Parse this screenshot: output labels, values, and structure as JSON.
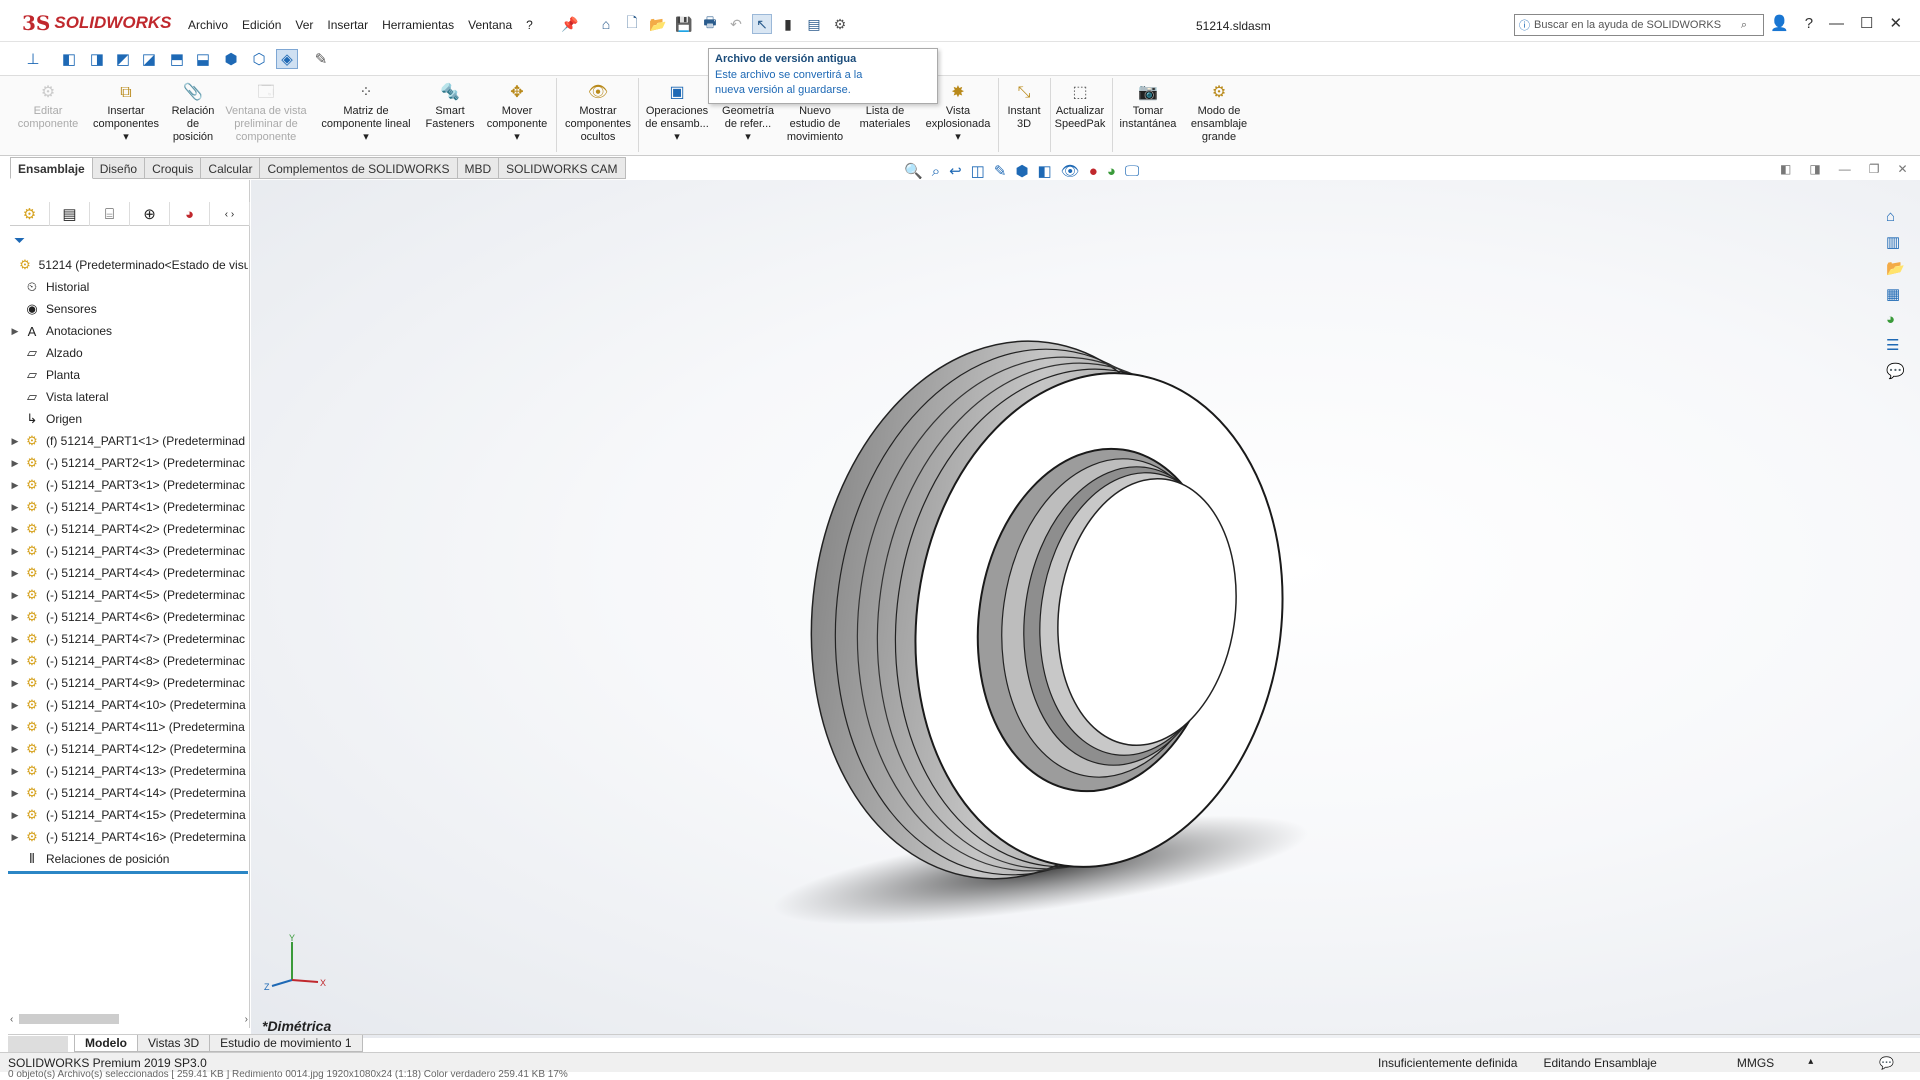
{
  "app": {
    "logo_ds": "3S",
    "logo_name": "SOLIDWORKS",
    "document_title": "51214.sldasm"
  },
  "menu": [
    "Archivo",
    "Edición",
    "Ver",
    "Insertar",
    "Herramientas",
    "Ventana",
    "?"
  ],
  "help_search": {
    "placeholder": "Buscar en la ayuda de SOLIDWORKS"
  },
  "tooltip": {
    "title": "Archivo de versión antigua",
    "line1": "Este archivo se convertirá a la",
    "line2": "nueva versión al guardarse."
  },
  "ribbon": [
    {
      "l1": "Editar",
      "l2": "componente",
      "l3": "",
      "l4": "",
      "icon": "edit-component-icon",
      "disabled": true
    },
    {
      "l1": "Insertar",
      "l2": "componentes",
      "l3": "▾",
      "l4": "",
      "icon": "insert-components-icon",
      "disabled": false
    },
    {
      "l1": "Relación",
      "l2": "de",
      "l3": "posición",
      "l4": "",
      "icon": "mate-icon",
      "disabled": false
    },
    {
      "l1": "Ventana de vista",
      "l2": "preliminar de",
      "l3": "componente",
      "l4": "",
      "icon": "preview-window-icon",
      "disabled": true
    },
    {
      "l1": "Matriz de",
      "l2": "componente lineal",
      "l3": "▾",
      "l4": "",
      "icon": "linear-pattern-icon",
      "disabled": false
    },
    {
      "l1": "Smart",
      "l2": "Fasteners",
      "l3": "",
      "l4": "",
      "icon": "smart-fasteners-icon",
      "disabled": false
    },
    {
      "l1": "Mover",
      "l2": "componente",
      "l3": "▾",
      "l4": "",
      "icon": "move-component-icon",
      "disabled": false
    },
    {
      "l1": "Mostrar",
      "l2": "componentes",
      "l3": "ocultos",
      "l4": "",
      "icon": "show-hidden-icon",
      "disabled": false
    },
    {
      "l1": "Operaciones",
      "l2": "de ensamb...",
      "l3": "▾",
      "l4": "",
      "icon": "assembly-features-icon",
      "disabled": false
    },
    {
      "l1": "Geometría",
      "l2": "de refer...",
      "l3": "▾",
      "l4": "",
      "icon": "reference-geometry-icon",
      "disabled": false
    },
    {
      "l1": "Nuevo",
      "l2": "estudio de",
      "l3": "movimiento",
      "l4": "",
      "icon": "motion-study-icon",
      "disabled": false
    },
    {
      "l1": "Lista de",
      "l2": "materiales",
      "l3": "",
      "l4": "",
      "icon": "bom-icon",
      "disabled": false
    },
    {
      "l1": "Vista",
      "l2": "explosionada",
      "l3": "▾",
      "l4": "",
      "icon": "exploded-view-icon",
      "disabled": false
    },
    {
      "l1": "Instant",
      "l2": "3D",
      "l3": "",
      "l4": "",
      "icon": "instant3d-icon",
      "disabled": false
    },
    {
      "l1": "Actualizar",
      "l2": "SpeedPak",
      "l3": "",
      "l4": "",
      "icon": "speedpak-icon",
      "disabled": false
    },
    {
      "l1": "Tomar",
      "l2": "instantánea",
      "l3": "",
      "l4": "",
      "icon": "snapshot-icon",
      "disabled": false
    },
    {
      "l1": "Modo de",
      "l2": "ensamblaje",
      "l3": "grande",
      "l4": "",
      "icon": "large-assembly-icon",
      "disabled": false
    }
  ],
  "command_tabs": [
    "Ensamblaje",
    "Diseño",
    "Croquis",
    "Calcular",
    "Complementos de SOLIDWORKS",
    "MBD",
    "SOLIDWORKS CAM"
  ],
  "tree": {
    "root": "51214  (Predeterminado<Estado de visua",
    "items": [
      {
        "label": "Historial",
        "icon": "history-icon",
        "expandable": false,
        "component": false
      },
      {
        "label": "Sensores",
        "icon": "sensors-icon",
        "expandable": false,
        "component": false
      },
      {
        "label": "Anotaciones",
        "icon": "annotations-icon",
        "expandable": true,
        "component": false
      },
      {
        "label": "Alzado",
        "icon": "plane-icon",
        "expandable": false,
        "component": false
      },
      {
        "label": "Planta",
        "icon": "plane-icon",
        "expandable": false,
        "component": false
      },
      {
        "label": "Vista lateral",
        "icon": "plane-icon",
        "expandable": false,
        "component": false
      },
      {
        "label": "Origen",
        "icon": "origin-icon",
        "expandable": false,
        "component": false
      },
      {
        "label": "(f) 51214_PART1<1> (Predeterminad",
        "icon": "component-icon",
        "expandable": true,
        "component": true
      },
      {
        "label": "(-) 51214_PART2<1> (Predeterminac",
        "icon": "component-icon",
        "expandable": true,
        "component": true
      },
      {
        "label": "(-) 51214_PART3<1> (Predeterminac",
        "icon": "component-icon",
        "expandable": true,
        "component": true
      },
      {
        "label": "(-) 51214_PART4<1> (Predeterminac",
        "icon": "component-icon",
        "expandable": true,
        "component": true
      },
      {
        "label": "(-) 51214_PART4<2> (Predeterminac",
        "icon": "component-icon",
        "expandable": true,
        "component": true
      },
      {
        "label": "(-) 51214_PART4<3> (Predeterminac",
        "icon": "component-icon",
        "expandable": true,
        "component": true
      },
      {
        "label": "(-) 51214_PART4<4> (Predeterminac",
        "icon": "component-icon",
        "expandable": true,
        "component": true
      },
      {
        "label": "(-) 51214_PART4<5> (Predeterminac",
        "icon": "component-icon",
        "expandable": true,
        "component": true
      },
      {
        "label": "(-) 51214_PART4<6> (Predeterminac",
        "icon": "component-icon",
        "expandable": true,
        "component": true
      },
      {
        "label": "(-) 51214_PART4<7> (Predeterminac",
        "icon": "component-icon",
        "expandable": true,
        "component": true
      },
      {
        "label": "(-) 51214_PART4<8> (Predeterminac",
        "icon": "component-icon",
        "expandable": true,
        "component": true
      },
      {
        "label": "(-) 51214_PART4<9> (Predeterminac",
        "icon": "component-icon",
        "expandable": true,
        "component": true
      },
      {
        "label": "(-) 51214_PART4<10> (Predetermina",
        "icon": "component-icon",
        "expandable": true,
        "component": true
      },
      {
        "label": "(-) 51214_PART4<11> (Predetermina",
        "icon": "component-icon",
        "expandable": true,
        "component": true
      },
      {
        "label": "(-) 51214_PART4<12> (Predetermina",
        "icon": "component-icon",
        "expandable": true,
        "component": true
      },
      {
        "label": "(-) 51214_PART4<13> (Predetermina",
        "icon": "component-icon",
        "expandable": true,
        "component": true
      },
      {
        "label": "(-) 51214_PART4<14> (Predetermina",
        "icon": "component-icon",
        "expandable": true,
        "component": true
      },
      {
        "label": "(-) 51214_PART4<15> (Predetermina",
        "icon": "component-icon",
        "expandable": true,
        "component": true
      },
      {
        "label": "(-) 51214_PART4<16> (Predetermina",
        "icon": "component-icon",
        "expandable": true,
        "component": true
      },
      {
        "label": "Relaciones de posición",
        "icon": "mates-icon",
        "expandable": false,
        "component": false
      }
    ]
  },
  "viewport": {
    "view_label": "*Dimétrica",
    "triad": {
      "x": "X",
      "y": "Y",
      "z": "Z"
    }
  },
  "bottom_tabs": [
    "Modelo",
    "Vistas 3D",
    "Estudio de movimiento 1"
  ],
  "status": {
    "left": "SOLIDWORKS Premium 2019 SP3.0",
    "definition": "Insuficientemente definida",
    "mode": "Editando Ensamblaje",
    "units": "MMGS",
    "units_arrow": "▴",
    "bottom_line": "0 objeto(s)   Archivo(s) seleccionados  [ 259.41 KB ]   Redimiento 0014.jpg   1920x1080x24 (1:18)   Color verdadero   259.41 KB   17%"
  },
  "colors": {
    "brand": "#c0282d",
    "accent": "#1e69b5",
    "component": "#d6a21e",
    "tree_end": "#2b86c5"
  }
}
